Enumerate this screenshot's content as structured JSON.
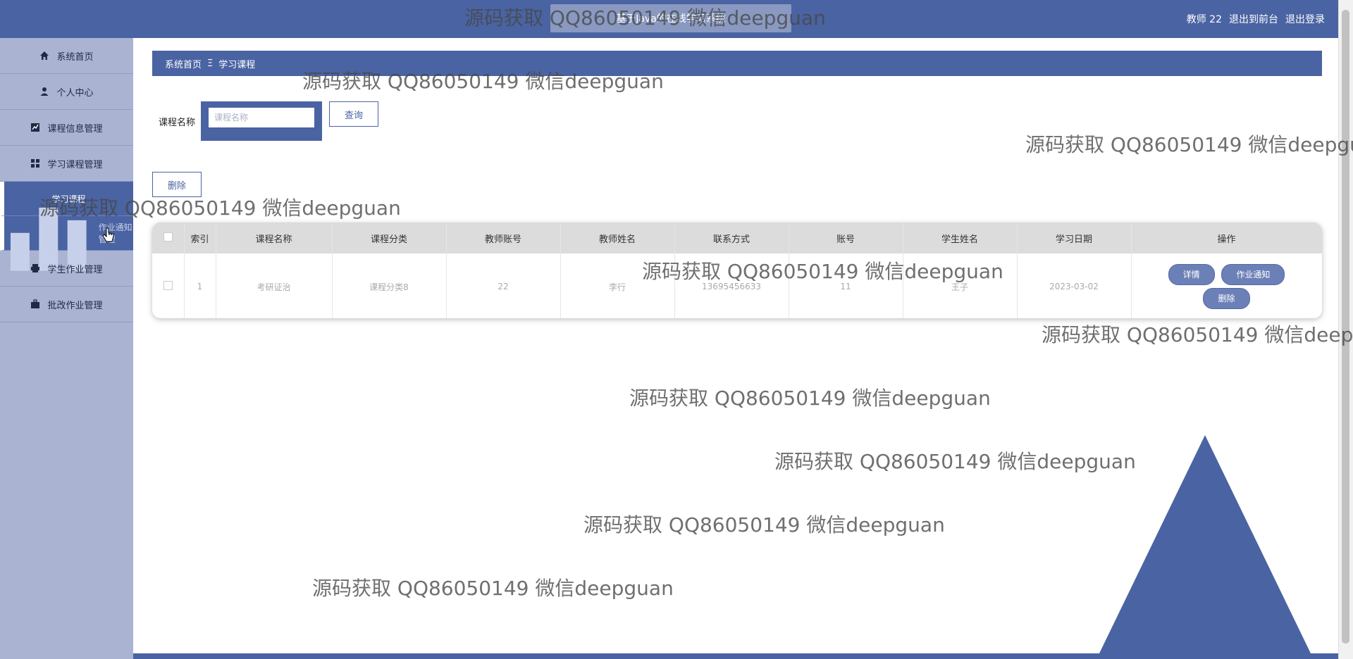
{
  "header": {
    "title": "基于Java的在线学习系统",
    "user_label": "教师 22",
    "back_front": "退出到前台",
    "logout": "退出登录"
  },
  "sidebar": {
    "items": [
      {
        "label": "系统首页",
        "icon": "home-icon"
      },
      {
        "label": "个人中心",
        "icon": "user-icon"
      },
      {
        "label": "课程信息管理",
        "icon": "chart-icon"
      },
      {
        "label": "学习课程管理",
        "icon": "grid-icon"
      }
    ],
    "sub_items": [
      {
        "label": "学习课程"
      },
      {
        "label": "作业通知管理",
        "icon": "bar-chart-icon"
      }
    ],
    "items_after": [
      {
        "label": "学生作业管理",
        "icon": "printer-icon"
      },
      {
        "label": "批改作业管理",
        "icon": "briefcase-icon"
      }
    ]
  },
  "breadcrumb": {
    "home": "系统首页",
    "separator": "Ξ",
    "current": "学习课程"
  },
  "search": {
    "label": "课程名称",
    "placeholder": "课程名称",
    "button": "查询"
  },
  "actions": {
    "delete": "删除"
  },
  "table": {
    "headers": [
      "索引",
      "课程名称",
      "课程分类",
      "教师账号",
      "教师姓名",
      "联系方式",
      "账号",
      "学生姓名",
      "学习日期",
      "操作"
    ],
    "rows": [
      {
        "index": "1",
        "course": "考研证治",
        "category": "课程分类8",
        "teacher_account": "22",
        "teacher_name": "李行",
        "contact": "13695456633",
        "account": "11",
        "student_name": "王子",
        "date": "2023-03-02"
      }
    ],
    "row_actions": {
      "detail": "详情",
      "notice": "作业通知",
      "delete": "删除"
    }
  },
  "watermark_text": "源码获取 QQ86050149 微信deepguan",
  "colors": {
    "primary": "#4a63a2",
    "sidebar": "#aab4d2",
    "pill": "#6c80b8"
  }
}
